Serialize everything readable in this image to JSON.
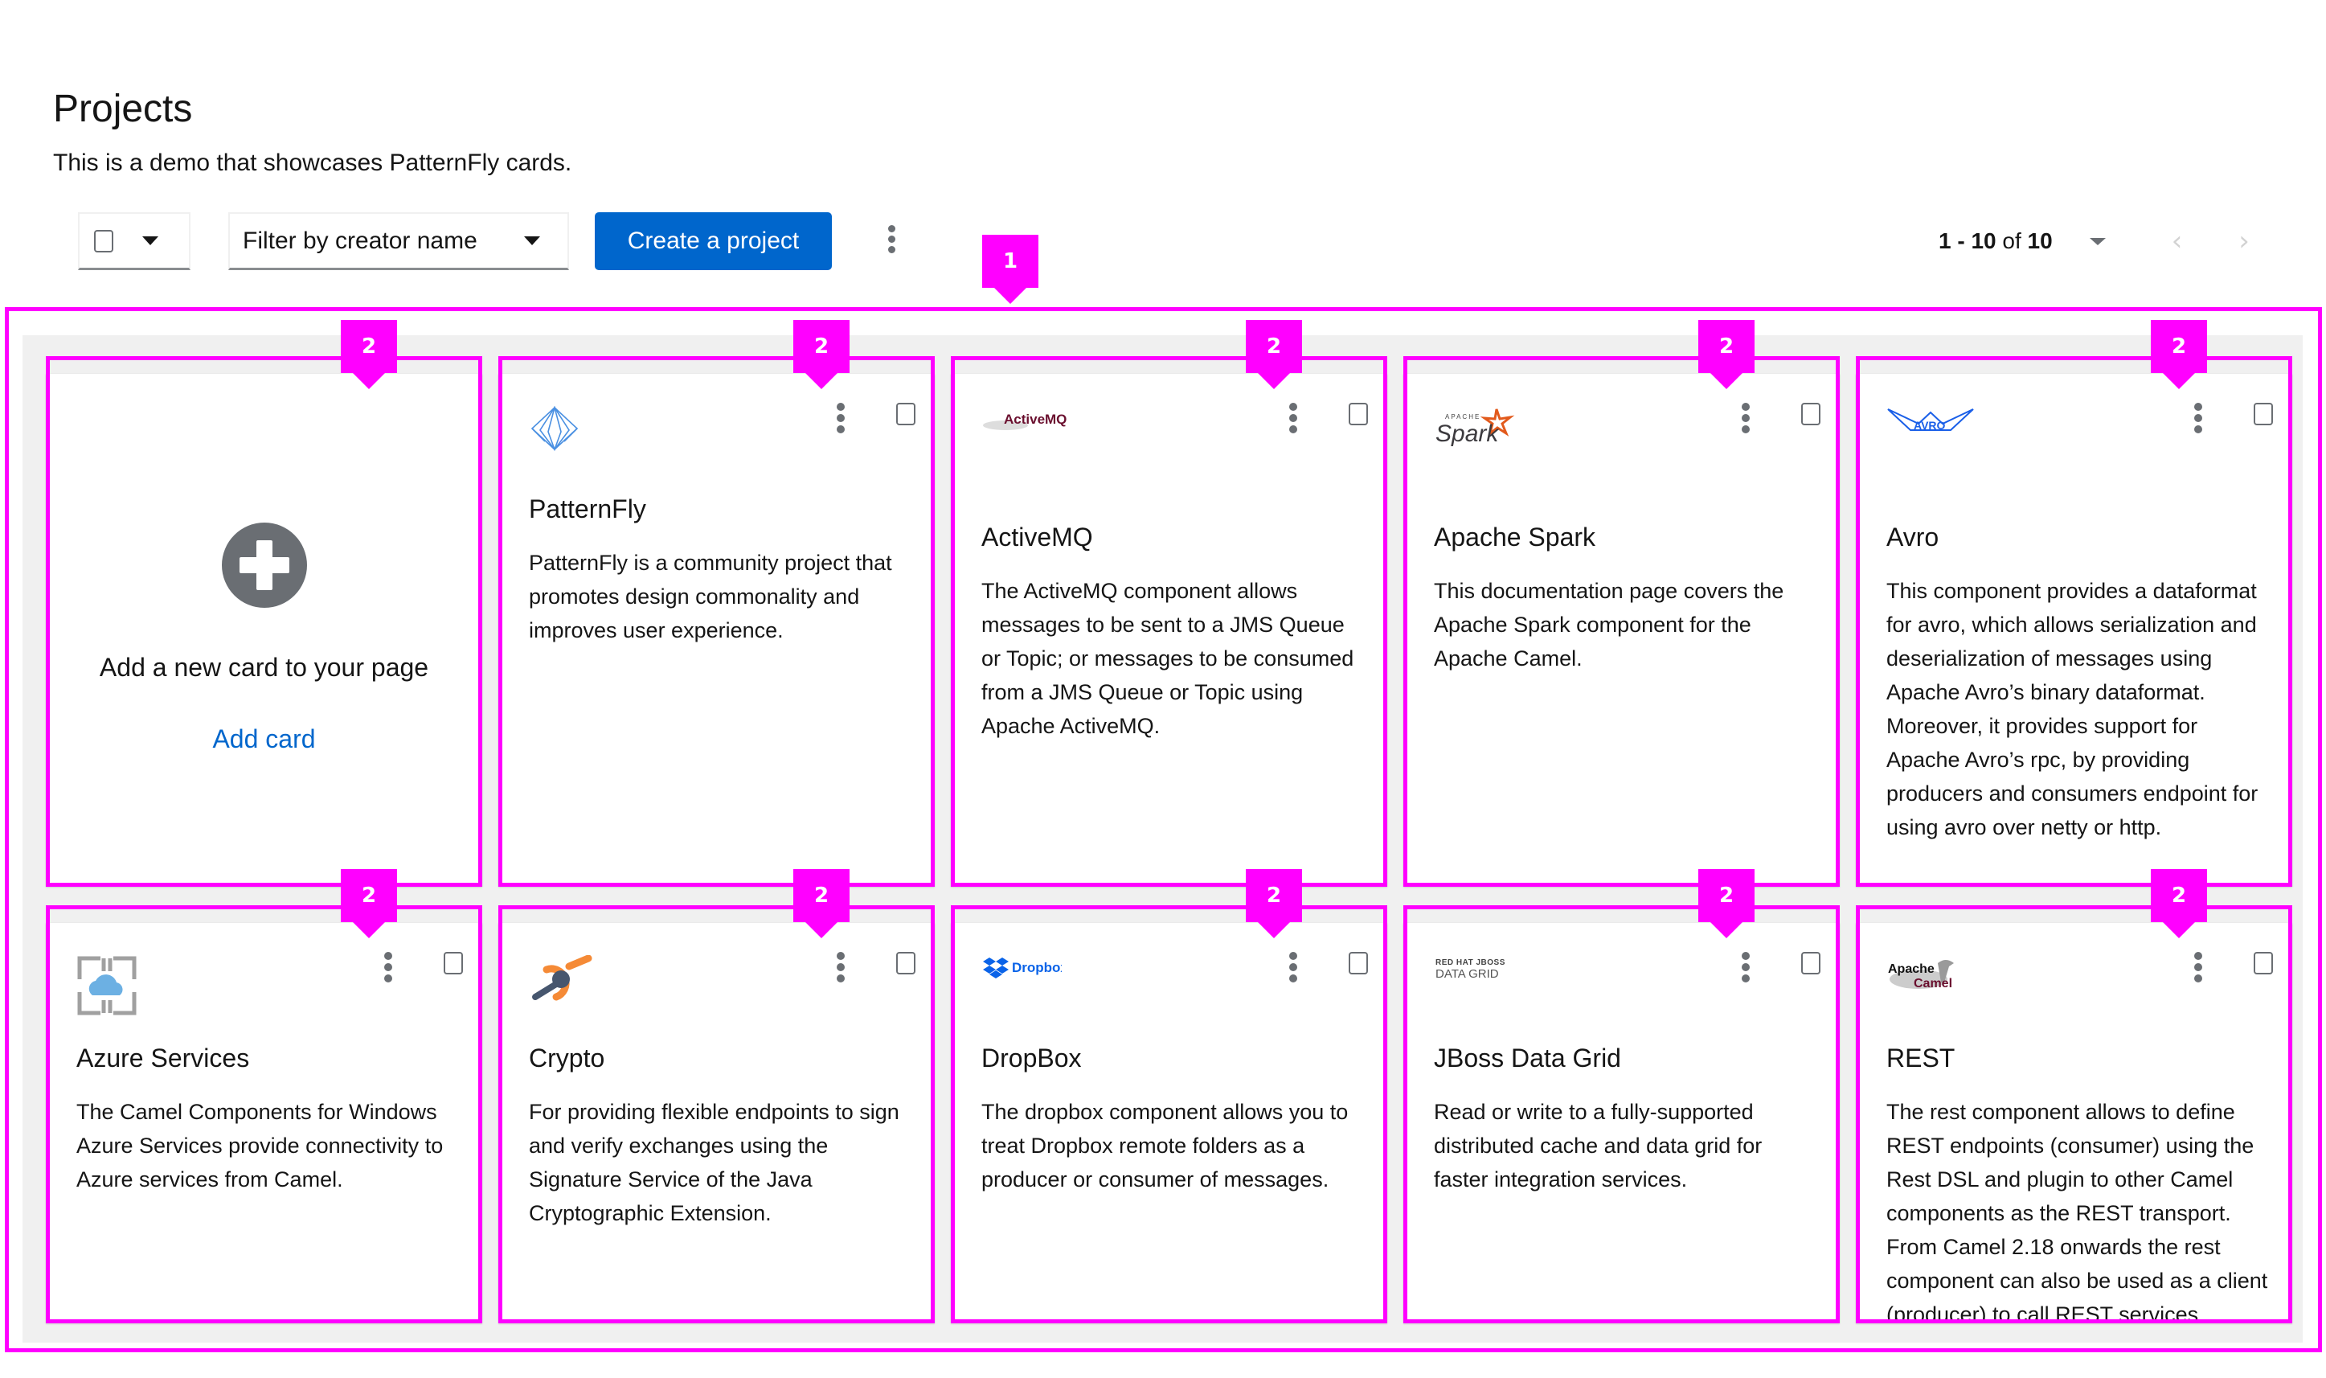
{
  "header": {
    "title": "Projects",
    "description": "This is a demo that showcases PatternFly cards."
  },
  "toolbar": {
    "filter_label": "Filter by creator name",
    "create_label": "Create a project",
    "pagination": {
      "range": "1 - 10",
      "of_label": "of",
      "total": "10",
      "prev_icon": "‹",
      "next_icon": "›"
    }
  },
  "add_card": {
    "title": "Add a new card to your page",
    "link": "Add card"
  },
  "cards": [
    {
      "title": "PatternFly",
      "logo": "patternfly-logo",
      "body": "PatternFly is a community project that promotes design commonality and improves user experience."
    },
    {
      "title": "ActiveMQ",
      "logo": "activemq-logo",
      "logo_text": "ActiveMQ",
      "body": "The ActiveMQ component allows messages to be sent to a JMS Queue or Topic; or messages to be consumed from a JMS Queue or Topic using Apache ActiveMQ."
    },
    {
      "title": "Apache Spark",
      "logo": "spark-logo",
      "logo_text": "Spark",
      "logo_subtext": "APACHE",
      "body": "This documentation page covers the Apache Spark component for the Apache Camel."
    },
    {
      "title": "Avro",
      "logo": "avro-logo",
      "logo_text": "AVRO",
      "body": "This component provides a dataformat for avro, which allows serialization and deserialization of messages using Apache Avro’s binary dataformat. Moreover, it provides support for Apache Avro’s rpc, by providing producers and consumers endpoint for using avro over netty or http."
    },
    {
      "title": "Azure Services",
      "logo": "azure-logo",
      "body": "The Camel Components for Windows Azure Services provide connectivity to Azure services from Camel."
    },
    {
      "title": "Crypto",
      "logo": "crypto-logo",
      "body": "For providing flexible endpoints to sign and verify exchanges using the Signature Service of the Java Cryptographic Extension."
    },
    {
      "title": "DropBox",
      "logo": "dropbox-logo",
      "logo_text": "Dropbox",
      "body": "The dropbox component allows you to treat Dropbox remote folders as a producer or consumer of messages."
    },
    {
      "title": "JBoss Data Grid",
      "logo": "jboss-datagrid-logo",
      "logo_text": "RED HAT JBOSS",
      "logo_subtext": "DATA GRID",
      "body": "Read or write to a fully-supported distributed cache and data grid for faster integration services."
    },
    {
      "title": "REST",
      "logo": "apache-camel-logo",
      "logo_text": "Apache",
      "logo_subtext": "Camel",
      "body": "The rest component allows to define REST endpoints (consumer) using the Rest DSL and plugin to other Camel components as the REST transport. From Camel 2.18 onwards the rest component can also be used as a client (producer) to call REST services."
    }
  ],
  "annotations": {
    "gallery_badge": "1",
    "card_badge": "2"
  }
}
